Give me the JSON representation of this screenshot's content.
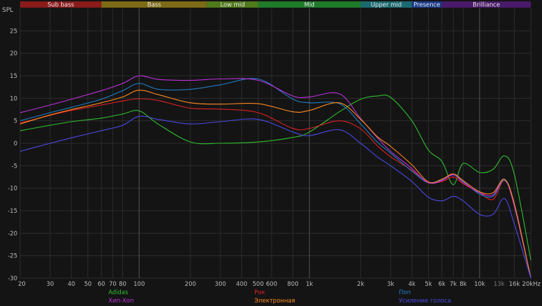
{
  "chart_data": {
    "type": "line",
    "ylabel": "SPL",
    "x_unit": "Hz",
    "xscale": "log",
    "xlim": [
      20,
      20000
    ],
    "ylim": [
      -30,
      30
    ],
    "grid": true,
    "legend_position": "bottom",
    "background": "#141414",
    "bands": [
      {
        "name": "Sub bass",
        "from": 20,
        "to": 60,
        "color": "#8b1a1a"
      },
      {
        "name": "Bass",
        "from": 60,
        "to": 250,
        "color": "#7d6a14"
      },
      {
        "name": "Low mid",
        "from": 250,
        "to": 500,
        "color": "#4f7a1a"
      },
      {
        "name": "Mid",
        "from": 500,
        "to": 2000,
        "color": "#1f7a2a"
      },
      {
        "name": "Upper mid",
        "from": 2000,
        "to": 4000,
        "color": "#1a6a70"
      },
      {
        "name": "Presence",
        "from": 4000,
        "to": 6000,
        "color": "#1a3a8a"
      },
      {
        "name": "Brilliance",
        "from": 6000,
        "to": 20000,
        "color": "#4a1a6a"
      }
    ],
    "x_ticks": [
      {
        "value": 20,
        "label": "20"
      },
      {
        "value": 30,
        "label": "30"
      },
      {
        "value": 40,
        "label": "40"
      },
      {
        "value": 50,
        "label": "50"
      },
      {
        "value": 60,
        "label": "60"
      },
      {
        "value": 70,
        "label": "70"
      },
      {
        "value": 80,
        "label": "80"
      },
      {
        "value": 100,
        "label": "100"
      },
      {
        "value": 200,
        "label": "200"
      },
      {
        "value": 300,
        "label": "300"
      },
      {
        "value": 400,
        "label": "400"
      },
      {
        "value": 500,
        "label": "500"
      },
      {
        "value": 600,
        "label": "600"
      },
      {
        "value": 800,
        "label": "800"
      },
      {
        "value": 1000,
        "label": "1k"
      },
      {
        "value": 2000,
        "label": "2k"
      },
      {
        "value": 3000,
        "label": "3k"
      },
      {
        "value": 4000,
        "label": "4k"
      },
      {
        "value": 5000,
        "label": "5k"
      },
      {
        "value": 6000,
        "label": "6k"
      },
      {
        "value": 7000,
        "label": "7k"
      },
      {
        "value": 8000,
        "label": "8k"
      },
      {
        "value": 10000,
        "label": "10k"
      },
      {
        "value": 13000,
        "label": "13k"
      },
      {
        "value": 16000,
        "label": "16k"
      },
      {
        "value": 20000,
        "label": "20kHz"
      }
    ],
    "x_major": [
      100,
      1000,
      10000
    ],
    "y_ticks": [
      -30,
      -25,
      -20,
      -15,
      -10,
      -5,
      0,
      5,
      10,
      15,
      20,
      25
    ],
    "series": [
      {
        "name": "Adidas",
        "color": "#2fbf2f",
        "x": [
          20,
          30,
          40,
          60,
          80,
          100,
          130,
          200,
          300,
          500,
          800,
          1000,
          1500,
          2000,
          2500,
          3000,
          4000,
          5000,
          6000,
          7000,
          8000,
          10000,
          12000,
          14000,
          16000,
          20000
        ],
        "y": [
          2.8,
          4,
          4.8,
          5.6,
          6.5,
          7.2,
          4.2,
          0.3,
          0,
          0.3,
          1.3,
          2.5,
          7,
          9.8,
          10.5,
          10.2,
          5,
          -1.5,
          -4,
          -9.2,
          -4.5,
          -6.5,
          -5.8,
          -2.8,
          -7,
          -26
        ]
      },
      {
        "name": "Рок",
        "color": "#e02020",
        "x": [
          20,
          30,
          40,
          60,
          80,
          100,
          130,
          200,
          300,
          500,
          800,
          1000,
          1500,
          2000,
          2500,
          3000,
          4000,
          5000,
          6000,
          7000,
          8000,
          10000,
          12000,
          14000,
          16000,
          20000
        ],
        "y": [
          4.5,
          6.2,
          7.3,
          8.5,
          9.4,
          9.9,
          9.5,
          7.8,
          7.6,
          6.8,
          3.3,
          3.3,
          5,
          3.2,
          -0.5,
          -3,
          -6,
          -8.7,
          -8.5,
          -7.5,
          -9,
          -11,
          -12.5,
          -8.3,
          -14,
          -30
        ]
      },
      {
        "name": "Поп",
        "color": "#1e7ec8",
        "x": [
          20,
          30,
          40,
          60,
          80,
          100,
          130,
          200,
          300,
          500,
          800,
          1000,
          1500,
          2000,
          2500,
          3000,
          4000,
          5000,
          6000,
          7000,
          8000,
          10000,
          12000,
          14000,
          16000,
          20000
        ],
        "y": [
          5,
          6.8,
          8,
          9.8,
          11.7,
          13.3,
          12,
          12,
          13,
          14.3,
          9.8,
          9,
          8.8,
          4.3,
          0.3,
          -2.2,
          -6.2,
          -8.8,
          -8.2,
          -7,
          -8.5,
          -11.3,
          -11.8,
          -8.2,
          -14,
          -30
        ]
      },
      {
        "name": "Хип-Хоп",
        "color": "#c030e0",
        "x": [
          20,
          30,
          40,
          60,
          80,
          100,
          130,
          200,
          300,
          500,
          800,
          1000,
          1500,
          2000,
          2500,
          3000,
          4000,
          5000,
          6000,
          7000,
          8000,
          10000,
          12000,
          14000,
          16000,
          20000
        ],
        "y": [
          6.8,
          8.5,
          9.8,
          11.7,
          13.3,
          15,
          14.2,
          14,
          14.3,
          14,
          10.5,
          10.3,
          11,
          5.5,
          1.3,
          -1.8,
          -5.6,
          -8.8,
          -8.3,
          -7,
          -8.7,
          -11,
          -11.5,
          -8,
          -14,
          -30
        ]
      },
      {
        "name": "Электронная",
        "color": "#ff8a20",
        "x": [
          20,
          30,
          40,
          60,
          80,
          100,
          130,
          200,
          300,
          500,
          800,
          1000,
          1500,
          2000,
          2500,
          3000,
          4000,
          5000,
          6000,
          7000,
          8000,
          10000,
          12000,
          14000,
          16000,
          20000
        ],
        "y": [
          4.3,
          6.3,
          7.5,
          9,
          10.3,
          11.8,
          10.8,
          9,
          8.7,
          8.8,
          7,
          7.3,
          9,
          5.3,
          1.5,
          -0.7,
          -4.8,
          -8.6,
          -8,
          -6.8,
          -8.3,
          -10.8,
          -11,
          -8,
          -13.5,
          -30
        ]
      },
      {
        "name": "Усиление голоса",
        "color": "#4a4ae8",
        "x": [
          20,
          30,
          40,
          60,
          80,
          100,
          130,
          200,
          300,
          500,
          800,
          1000,
          1500,
          2000,
          2500,
          3000,
          4000,
          5000,
          6000,
          7000,
          8000,
          10000,
          12000,
          14000,
          16000,
          20000
        ],
        "y": [
          -1.8,
          0,
          1.2,
          2.8,
          4,
          6,
          5.3,
          4.3,
          4.8,
          5.3,
          2.5,
          1.7,
          3,
          0,
          -3,
          -5,
          -8.5,
          -12,
          -12.8,
          -11.8,
          -12.8,
          -15.8,
          -15.8,
          -12.3,
          -18,
          -30
        ]
      }
    ]
  }
}
